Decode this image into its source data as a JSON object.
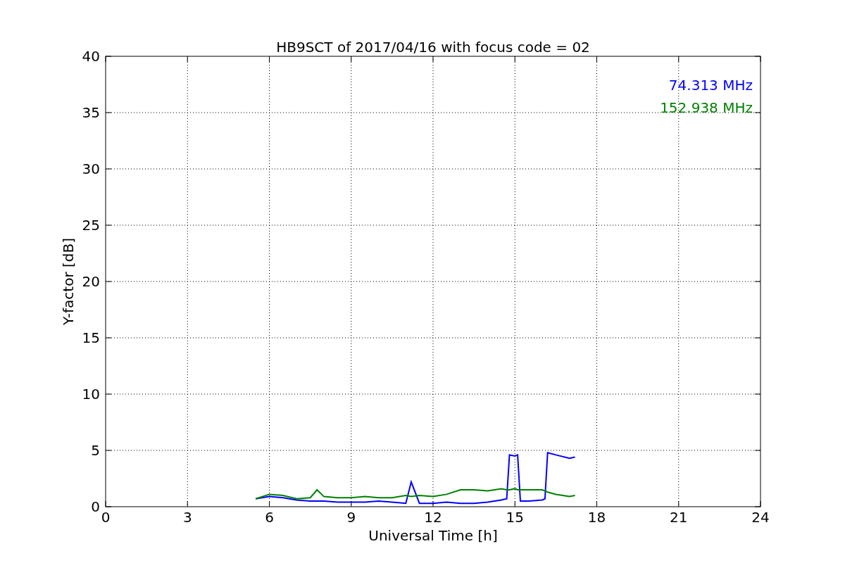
{
  "chart_data": {
    "type": "line",
    "title": "HB9SCT of 2017/04/16 with focus code = 02",
    "xlabel": "Universal Time [h]",
    "ylabel": "Y-factor [dB]",
    "x": [
      5.5,
      6,
      6.5,
      7,
      7.5,
      7.75,
      8,
      8.5,
      9,
      9.5,
      10,
      10.5,
      11,
      11.2,
      11.5,
      12,
      12.5,
      13,
      13.5,
      14,
      14.5,
      14.7,
      14.8,
      15,
      15.1,
      15.2,
      15.5,
      16,
      16.1,
      16.2,
      16.5,
      17,
      17.2
    ],
    "series": [
      {
        "name": "74.313 MHz",
        "color": "#0000ff",
        "values": [
          0.7,
          0.9,
          0.8,
          0.6,
          0.5,
          0.5,
          0.5,
          0.4,
          0.4,
          0.4,
          0.5,
          0.4,
          0.3,
          2.2,
          0.3,
          0.3,
          0.4,
          0.3,
          0.3,
          0.4,
          0.6,
          0.7,
          4.6,
          4.5,
          4.6,
          0.5,
          0.5,
          0.6,
          0.7,
          4.8,
          4.6,
          4.3,
          4.4
        ]
      },
      {
        "name": "152.938 MHz",
        "color": "#008000",
        "values": [
          0.7,
          1.1,
          1.0,
          0.7,
          0.8,
          1.5,
          0.9,
          0.8,
          0.8,
          0.9,
          0.8,
          0.8,
          1.0,
          0.9,
          1.0,
          0.9,
          1.1,
          1.5,
          1.5,
          1.4,
          1.6,
          1.5,
          1.5,
          1.6,
          1.5,
          1.5,
          1.5,
          1.5,
          1.4,
          1.3,
          1.1,
          0.9,
          1.0
        ]
      }
    ],
    "grid": true,
    "xlim": [
      0,
      24
    ],
    "ylim": [
      0,
      40
    ],
    "xticks": [
      0,
      3,
      6,
      9,
      12,
      15,
      18,
      21,
      24
    ],
    "yticks": [
      0,
      5,
      10,
      15,
      20,
      25,
      30,
      35,
      40
    ]
  }
}
